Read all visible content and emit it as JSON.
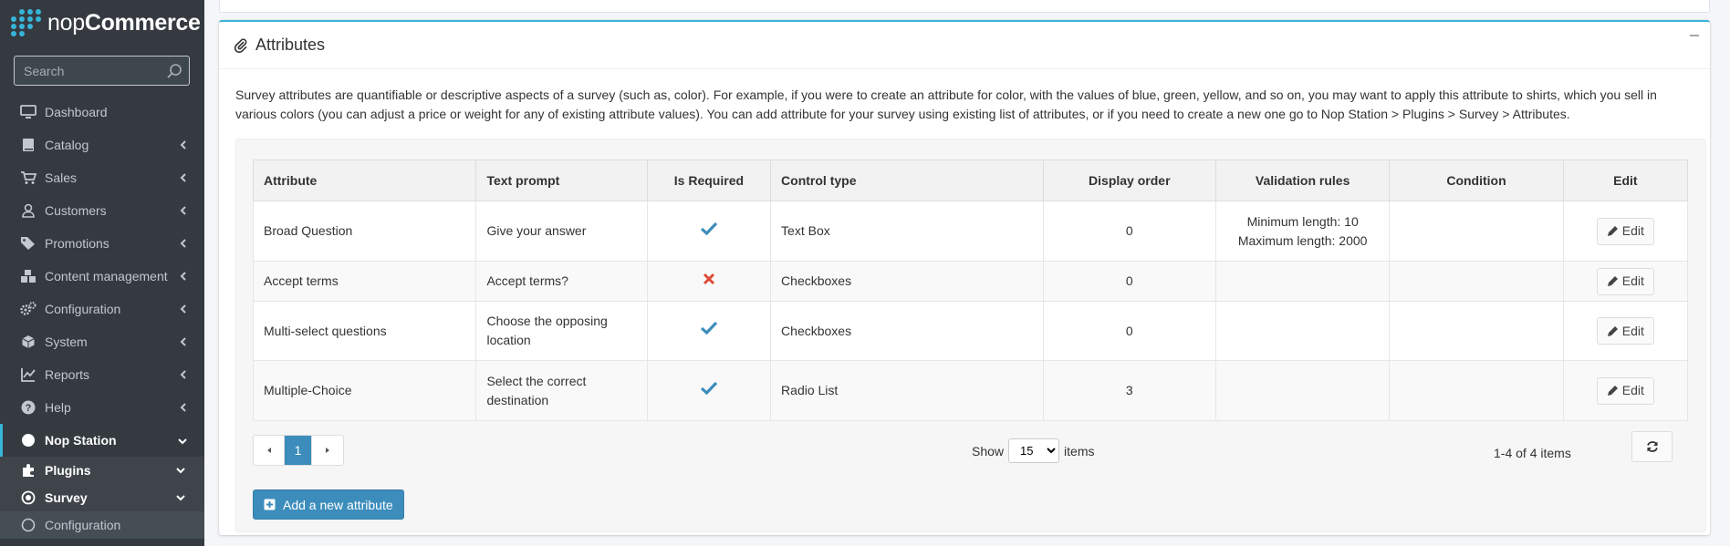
{
  "brand": {
    "name_thin": "nop",
    "name_bold": "Commerce"
  },
  "search": {
    "placeholder": "Search"
  },
  "sidebar": {
    "items": [
      {
        "label": "Dashboard",
        "icon": "monitor-icon"
      },
      {
        "label": "Catalog",
        "icon": "book-icon"
      },
      {
        "label": "Sales",
        "icon": "cart-icon"
      },
      {
        "label": "Customers",
        "icon": "user-icon"
      },
      {
        "label": "Promotions",
        "icon": "tags-icon"
      },
      {
        "label": "Content management",
        "icon": "cubes-icon"
      },
      {
        "label": "Configuration",
        "icon": "gears-icon"
      },
      {
        "label": "System",
        "icon": "cube-icon"
      },
      {
        "label": "Reports",
        "icon": "line-chart-icon"
      },
      {
        "label": "Help",
        "icon": "question-icon"
      },
      {
        "label": "Nop Station",
        "icon": "circle-icon"
      }
    ],
    "sub_items": [
      {
        "label": "Plugins",
        "icon": "puzzle-icon"
      },
      {
        "label": "Survey",
        "icon": "dot-circle-icon"
      },
      {
        "label": "Configuration",
        "icon": "circle-outline-icon"
      }
    ]
  },
  "card": {
    "title": "Attributes",
    "description": "Survey attributes are quantifiable or descriptive aspects of a survey (such as, color). For example, if you were to create an attribute for color, with the values of blue, green, yellow, and so on, you may want to apply this attribute to shirts, which you sell in various colors (you can adjust a price or weight for any of existing attribute values). You can add attribute for your survey using existing list of attributes, or if you need to create a new one go to Nop Station > Plugins > Survey > Attributes."
  },
  "table": {
    "headers": [
      "Attribute",
      "Text prompt",
      "Is Required",
      "Control type",
      "Display order",
      "Validation rules",
      "Condition",
      "Edit"
    ],
    "rows": [
      {
        "attribute": "Broad Question",
        "prompt": "Give your answer",
        "required": true,
        "control": "Text Box",
        "order": "0",
        "rule1": "Minimum length: 10",
        "rule2": "Maximum length: 2000",
        "condition": "",
        "edit": "Edit"
      },
      {
        "attribute": "Accept terms",
        "prompt": "Accept terms?",
        "required": false,
        "control": "Checkboxes",
        "order": "0",
        "rule1": "",
        "rule2": "",
        "condition": "",
        "edit": "Edit"
      },
      {
        "attribute": "Multi-select questions",
        "prompt1": "Choose the opposing",
        "prompt2": "location",
        "required": true,
        "control": "Checkboxes",
        "order": "0",
        "rule1": "",
        "rule2": "",
        "condition": "",
        "edit": "Edit"
      },
      {
        "attribute": "Multiple-Choice",
        "prompt1": "Select the correct",
        "prompt2": "destination",
        "required": true,
        "control": "Radio List",
        "order": "3",
        "rule1": "",
        "rule2": "",
        "condition": "",
        "edit": "Edit"
      }
    ]
  },
  "pager": {
    "current": "1",
    "show_label": "Show",
    "page_size": "15",
    "items_label": "items",
    "info": "1-4 of 4 items"
  },
  "actions": {
    "add_label": "Add a new attribute"
  },
  "colors": {
    "accent": "#37b5d8",
    "primary": "#3c8dbc",
    "check": "#3c8dbc",
    "cross": "#dd4b39",
    "sidebar": "#343a40"
  }
}
